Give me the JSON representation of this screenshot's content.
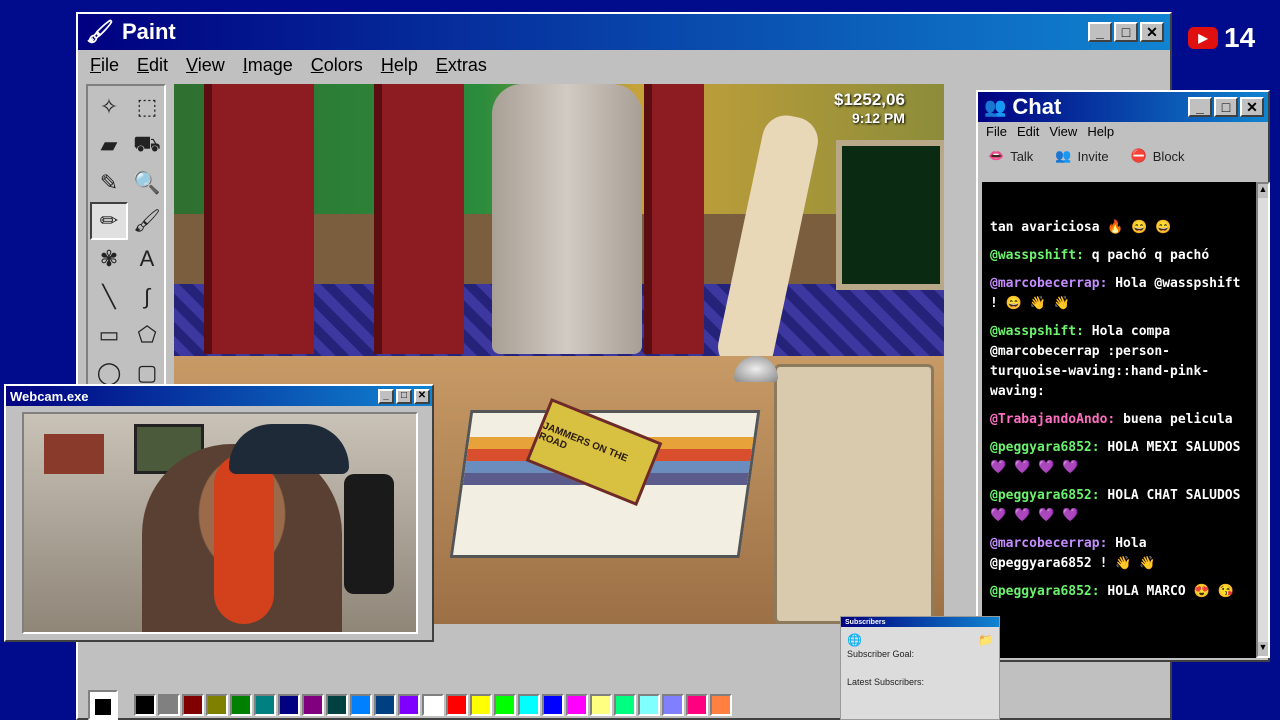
{
  "paint": {
    "title": "Paint",
    "menu": [
      "File",
      "Edit",
      "View",
      "Image",
      "Colors",
      "Help",
      "Extras"
    ],
    "controls": {
      "minimize": "_",
      "maximize": "□",
      "close": "✕"
    },
    "tools": [
      {
        "name": "free-select-icon",
        "glyph": "✧"
      },
      {
        "name": "rect-select-icon",
        "glyph": "⬚"
      },
      {
        "name": "eraser-icon",
        "glyph": "▰"
      },
      {
        "name": "fill-bucket-icon",
        "glyph": "⛟"
      },
      {
        "name": "eyedropper-icon",
        "glyph": "✎"
      },
      {
        "name": "magnifier-icon",
        "glyph": "🔍"
      },
      {
        "name": "pencil-icon",
        "glyph": "✏"
      },
      {
        "name": "brush-icon",
        "glyph": "🖌"
      },
      {
        "name": "airbrush-icon",
        "glyph": "✾"
      },
      {
        "name": "text-icon",
        "glyph": "A"
      },
      {
        "name": "line-icon",
        "glyph": "╲"
      },
      {
        "name": "curve-icon",
        "glyph": "∫"
      },
      {
        "name": "rectangle-icon",
        "glyph": "▭"
      },
      {
        "name": "polygon-icon",
        "glyph": "⬠"
      },
      {
        "name": "ellipse-icon",
        "glyph": "◯"
      },
      {
        "name": "rounded-rect-icon",
        "glyph": "▢"
      }
    ],
    "selected_tool": 6,
    "palette": [
      "#000000",
      "#808080",
      "#800000",
      "#808000",
      "#008000",
      "#008080",
      "#000080",
      "#800080",
      "#004040",
      "#0080ff",
      "#004080",
      "#8000ff",
      "#ffffff",
      "#ff0000",
      "#ffff00",
      "#00ff00",
      "#00ffff",
      "#0000ff",
      "#ff00ff",
      "#ffff80",
      "#00ff80",
      "#80ffff",
      "#8080ff",
      "#ff0080",
      "#ff8040"
    ]
  },
  "game": {
    "money": "$1252,06",
    "time": "9:12 PM",
    "vhs_title": "JAMMERS ON THE ROAD"
  },
  "webcam": {
    "title": "Webcam.exe",
    "controls": {
      "minimize": "_",
      "maximize": "□",
      "close": "✕"
    }
  },
  "chat": {
    "title": "Chat",
    "menu": [
      "File",
      "Edit",
      "View",
      "Help"
    ],
    "toolbar": [
      {
        "label": "Talk",
        "icon": "talk-icon",
        "glyph": "👄"
      },
      {
        "label": "Invite",
        "icon": "invite-icon",
        "glyph": "👥"
      },
      {
        "label": "Block",
        "icon": "block-icon",
        "glyph": "⛔"
      }
    ],
    "controls": {
      "minimize": "_",
      "maximize": "□",
      "close": "✕"
    },
    "messages": [
      {
        "user": "",
        "text": "tan avariciosa 🔥 😄 😄",
        "color": "u-g"
      },
      {
        "user": "@wasspshift:",
        "text": "q pachó q pachó",
        "color": "u-g"
      },
      {
        "user": "@marcobecerrap:",
        "text": "Hola @wasspshift ! 😄 👋 👋",
        "color": "u-p"
      },
      {
        "user": "@wasspshift:",
        "text": "Hola compa @marcobecerrap :person-turquoise-waving::hand-pink-waving:",
        "color": "u-g"
      },
      {
        "user": "@TrabajandoAndo:",
        "text": "buena pelicula",
        "color": "u-pk"
      },
      {
        "user": "@peggyara6852:",
        "text": "HOLA MEXI SALUDOS 💜 💜 💜 💜",
        "color": "u-g"
      },
      {
        "user": "@peggyara6852:",
        "text": "HOLA CHAT SALUDOS 💜 💜 💜 💜",
        "color": "u-g"
      },
      {
        "user": "@marcobecerrap:",
        "text": "Hola @peggyara6852 ! 👋 👋",
        "color": "u-p"
      },
      {
        "user": "@peggyara6852:",
        "text": "HOLA MARCO 😍 😘",
        "color": "u-g"
      }
    ]
  },
  "subscribers": {
    "title": "Subscribers",
    "goal_label": "Subscriber Goal:",
    "latest_label": "Latest Subscribers:"
  },
  "youtube": {
    "count": "14"
  }
}
